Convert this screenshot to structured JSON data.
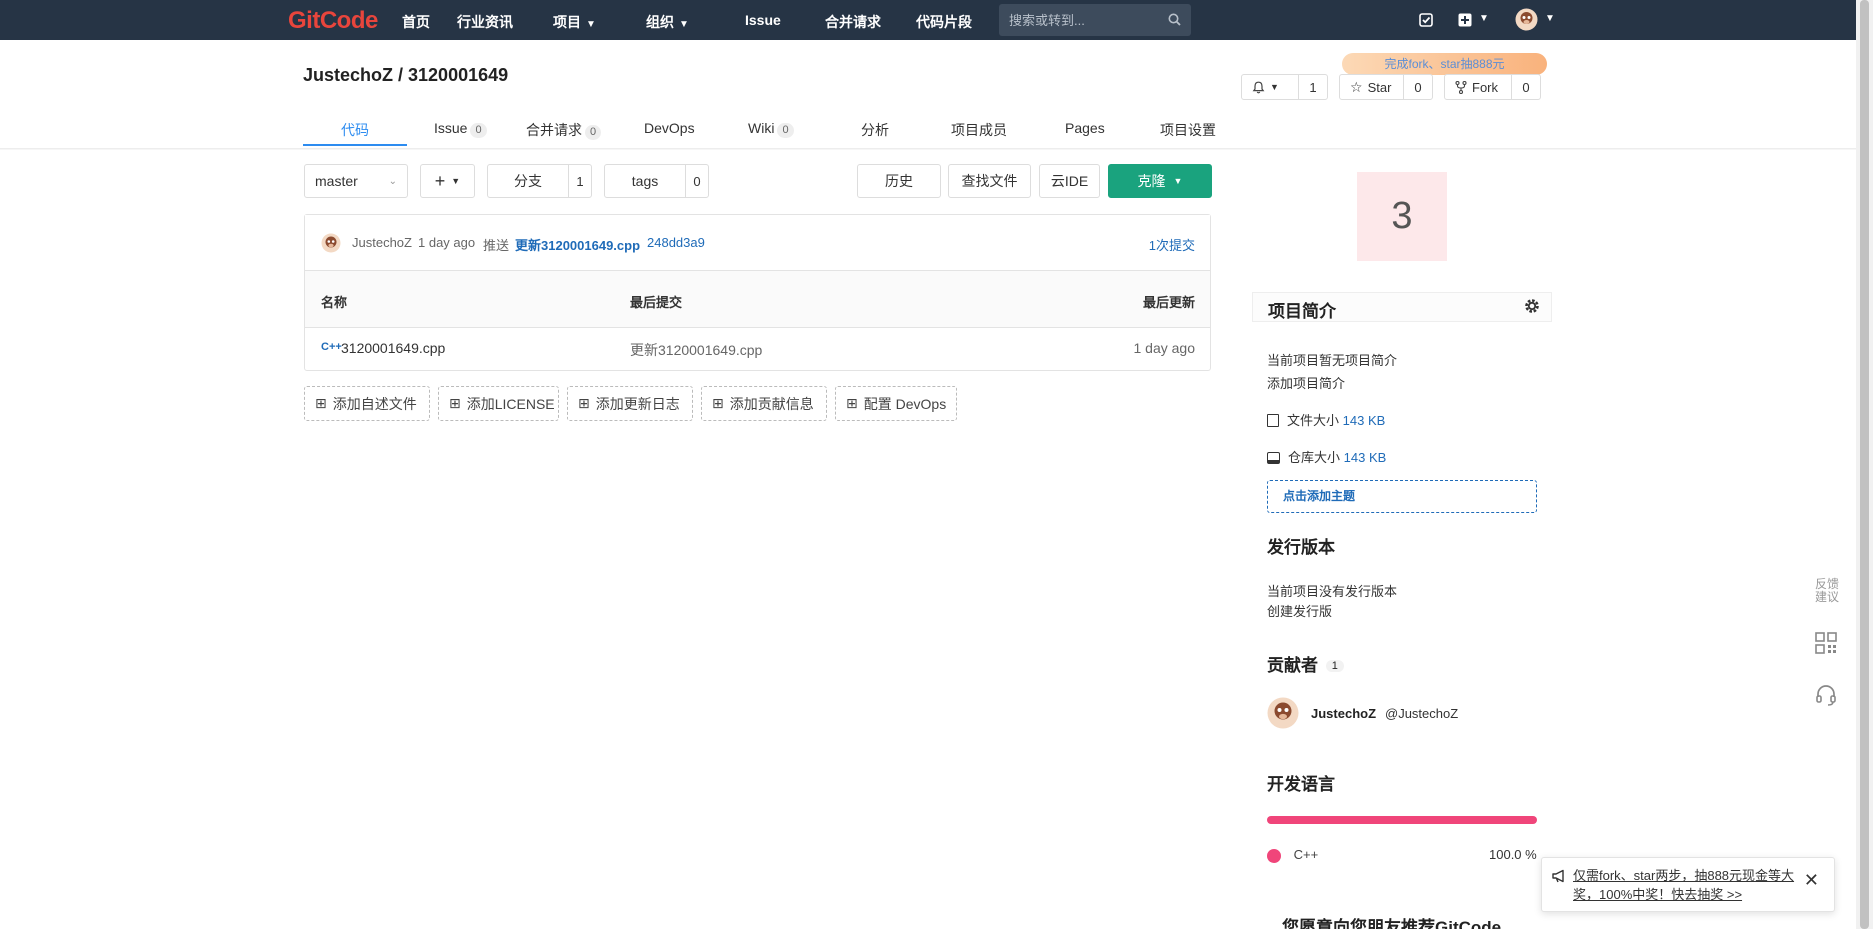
{
  "topnav": {
    "logo": "GitCode",
    "items": [
      "首页",
      "行业资讯",
      "项目",
      "组织",
      "Issue",
      "合并请求",
      "代码片段"
    ],
    "search_placeholder": "搜索或转到..."
  },
  "project": {
    "title": "JustechoZ / 3120001649",
    "promo": "完成fork、star抽888元",
    "watch_count": "1",
    "star_label": "Star",
    "star_count": "0",
    "fork_label": "Fork",
    "fork_count": "0"
  },
  "tabs": [
    {
      "label": "代码",
      "badge": ""
    },
    {
      "label": "Issue",
      "badge": "0"
    },
    {
      "label": "合并请求",
      "badge": "0"
    },
    {
      "label": "DevOps",
      "badge": ""
    },
    {
      "label": "Wiki",
      "badge": "0"
    },
    {
      "label": "分析",
      "badge": ""
    },
    {
      "label": "项目成员",
      "badge": ""
    },
    {
      "label": "Pages",
      "badge": ""
    },
    {
      "label": "项目设置",
      "badge": ""
    }
  ],
  "toolbar": {
    "branch": "master",
    "branches_label": "分支",
    "branches_count": "1",
    "tags_label": "tags",
    "tags_count": "0",
    "history": "历史",
    "find_file": "查找文件",
    "cloud_ide": "云IDE",
    "clone": "克隆"
  },
  "commit": {
    "author": "JustechoZ",
    "time": "1 day ago",
    "action": "推送",
    "message": "更新3120001649.cpp",
    "sha": "248dd3a9",
    "count_link": "1次提交"
  },
  "table": {
    "headers": [
      "名称",
      "最后提交",
      "最后更新"
    ],
    "rows": [
      {
        "name": "3120001649.cpp",
        "last_commit": "更新3120001649.cpp",
        "updated": "1 day ago",
        "icon": "cpp-file-icon"
      }
    ]
  },
  "add_buttons": [
    "添加自述文件",
    "添加LICENSE",
    "添加更新日志",
    "添加贡献信息",
    "配置 DevOps"
  ],
  "sidebar": {
    "avatar_letter": "3",
    "intro_title": "项目简介",
    "intro_empty": "当前项目暂无项目简介",
    "intro_add": "添加项目简介",
    "file_size_label": "文件大小",
    "file_size": "143 KB",
    "repo_size_label": "仓库大小",
    "repo_size": "143 KB",
    "add_topic": "点击添加主题",
    "release_title": "发行版本",
    "release_empty": "当前项目没有发行版本",
    "release_create": "创建发行版",
    "contrib_title": "贡献者",
    "contrib_count": "1",
    "contrib_name": "JustechoZ",
    "contrib_handle": "@JustechoZ",
    "lang_title": "开发语言",
    "lang_name": "C++",
    "lang_pct": "100.0 %",
    "lang_share": 1.0,
    "recommend_title": "您愿意向您朋友推荐GitCode"
  },
  "floating": {
    "feedback": "反馈\n建议"
  },
  "toast": {
    "text": "仅需fork、star两步，抽888元现金等大奖，100%中奖！快去抽奖 >>"
  },
  "colors": {
    "nav_bg": "#263445",
    "accent_blue": "#2d8cf0",
    "clone_green": "#1aa37e",
    "lang_cpp": "#f0457a"
  }
}
